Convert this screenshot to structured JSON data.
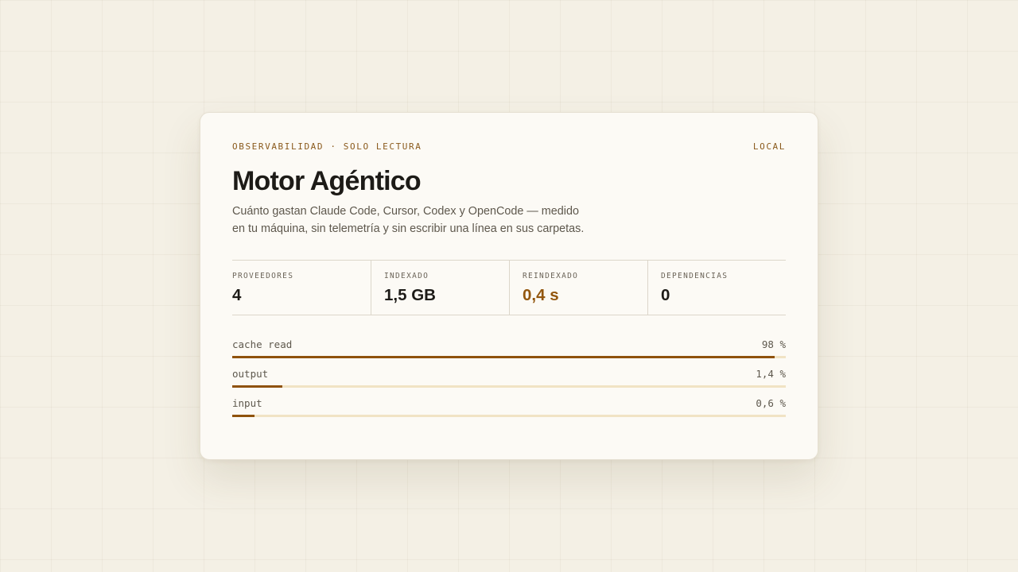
{
  "card": {
    "eyebrow": "OBSERVABILIDAD · SOLO LECTURA",
    "badge": "LOCAL",
    "title": "Motor Agéntico",
    "description": "Cuánto gastan Claude Code, Cursor, Codex y OpenCode — medido en tu máquina, sin telemetría y sin escribir una línea en sus carpetas."
  },
  "stats": [
    {
      "label": "PROVEEDORES",
      "value": "4",
      "accent": false
    },
    {
      "label": "INDEXADO",
      "value": "1,5 GB",
      "accent": false
    },
    {
      "label": "REINDEXADO",
      "value": "0,4 s",
      "accent": true
    },
    {
      "label": "DEPENDENCIAS",
      "value": "0",
      "accent": false
    }
  ],
  "bars": [
    {
      "label": "cache read",
      "value_text": "98 %",
      "fill_percent": 98
    },
    {
      "label": "output",
      "value_text": "1,4 %",
      "fill_percent": 9
    },
    {
      "label": "input",
      "value_text": "0,6 %",
      "fill_percent": 4
    }
  ],
  "colors": {
    "accent": "#8f520c",
    "track": "#f1e3c4",
    "background": "#f4f0e5",
    "card": "#fcfaf5"
  }
}
